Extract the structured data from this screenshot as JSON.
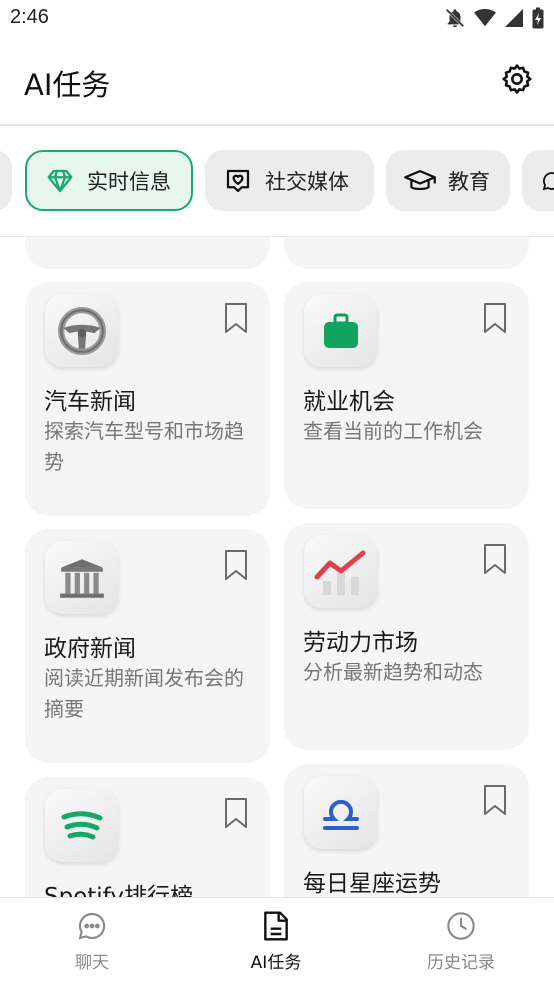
{
  "status_bar": {
    "time": "2:46"
  },
  "header": {
    "title": "AI任务"
  },
  "categories": [
    {
      "label": "实时信息",
      "icon": "diamond-icon",
      "active": true
    },
    {
      "label": "社交媒体",
      "icon": "heart-chat-icon",
      "active": false
    },
    {
      "label": "教育",
      "icon": "graduation-cap-icon",
      "active": false
    }
  ],
  "cards": [
    {
      "title": "汽车新闻",
      "desc": "探索汽车型号和市场趋势",
      "icon": "steering-wheel-icon"
    },
    {
      "title": "就业机会",
      "desc": "查看当前的工作机会",
      "icon": "briefcase-icon"
    },
    {
      "title": "政府新闻",
      "desc": "阅读近期新闻发布会的摘要",
      "icon": "government-building-icon"
    },
    {
      "title": "劳动力市场",
      "desc": "分析最新趋势和动态",
      "icon": "trend-chart-icon"
    },
    {
      "title": "Spotify排行榜",
      "desc": "",
      "icon": "spotify-icon"
    },
    {
      "title": "每日星座运势",
      "desc": "",
      "icon": "libra-icon"
    }
  ],
  "nav": [
    {
      "label": "聊天",
      "icon": "chat-bubble-icon",
      "active": false
    },
    {
      "label": "AI任务",
      "icon": "document-icon",
      "active": true
    },
    {
      "label": "历史记录",
      "icon": "clock-icon",
      "active": false
    }
  ],
  "colors": {
    "accent": "#1aa870",
    "chip_bg": "#ececec",
    "card_bg": "#f5f5f5"
  }
}
